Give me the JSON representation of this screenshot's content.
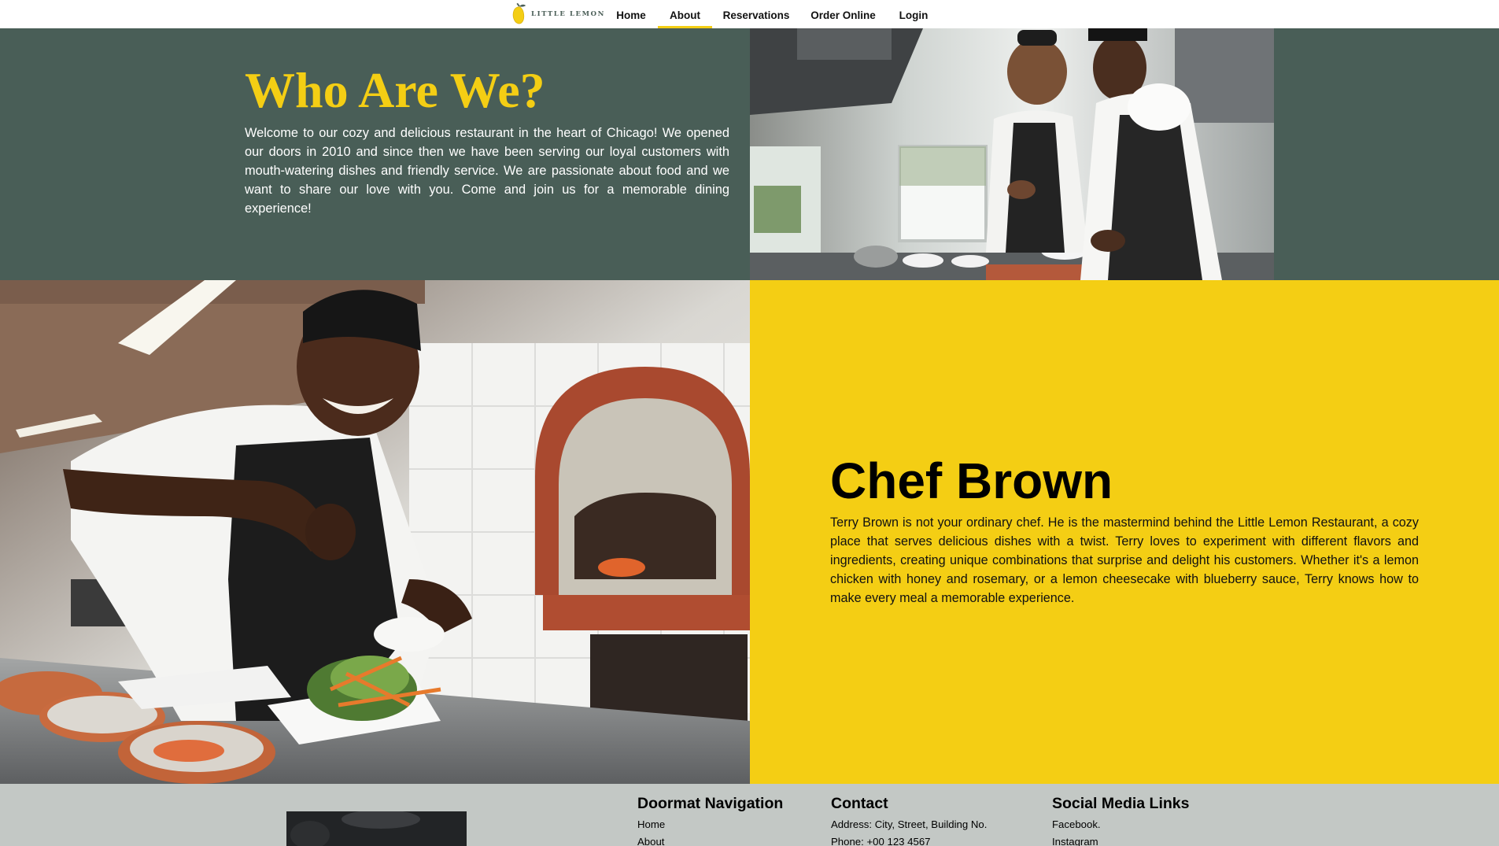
{
  "nav": {
    "logo_text": "LITTLE LEMON",
    "links": [
      {
        "label": "Home",
        "active": false
      },
      {
        "label": "About",
        "active": true
      },
      {
        "label": "Reservations",
        "active": false
      },
      {
        "label": "Order Online",
        "active": false
      },
      {
        "label": "Login",
        "active": false
      }
    ]
  },
  "about": {
    "title": "Who Are We?",
    "text": "Welcome to our cozy and delicious restaurant in the heart of Chicago! We opened our doors in 2010 and since then we have been serving our loyal customers with mouth-watering dishes and friendly service. We are passionate about food and we want to share our love with you. Come and join us for a memorable dining experience!"
  },
  "chef": {
    "title": "Chef Brown",
    "text": "Terry Brown is not your ordinary chef. He is the mastermind behind the Little Lemon Restaurant, a cozy place that serves delicious dishes with a twist. Terry loves to experiment with different flavors and ingredients, creating unique combinations that surprise and delight his customers. Whether it's a lemon chicken with honey and rosemary, or a lemon cheesecake with blueberry sauce, Terry knows how to make every meal a memorable experience."
  },
  "footer": {
    "nav": {
      "heading": "Doormat Navigation",
      "items": [
        "Home",
        "About"
      ]
    },
    "contact": {
      "heading": "Contact",
      "address": "Address: City, Street, Building No.",
      "phone": "Phone: +00 123 4567"
    },
    "social": {
      "heading": "Social Media Links",
      "items": [
        "Facebook.",
        "Instagram"
      ]
    }
  },
  "colors": {
    "primary_green": "#495e57",
    "primary_yellow": "#f4ce14",
    "footer_gray": "#c3c8c5"
  }
}
